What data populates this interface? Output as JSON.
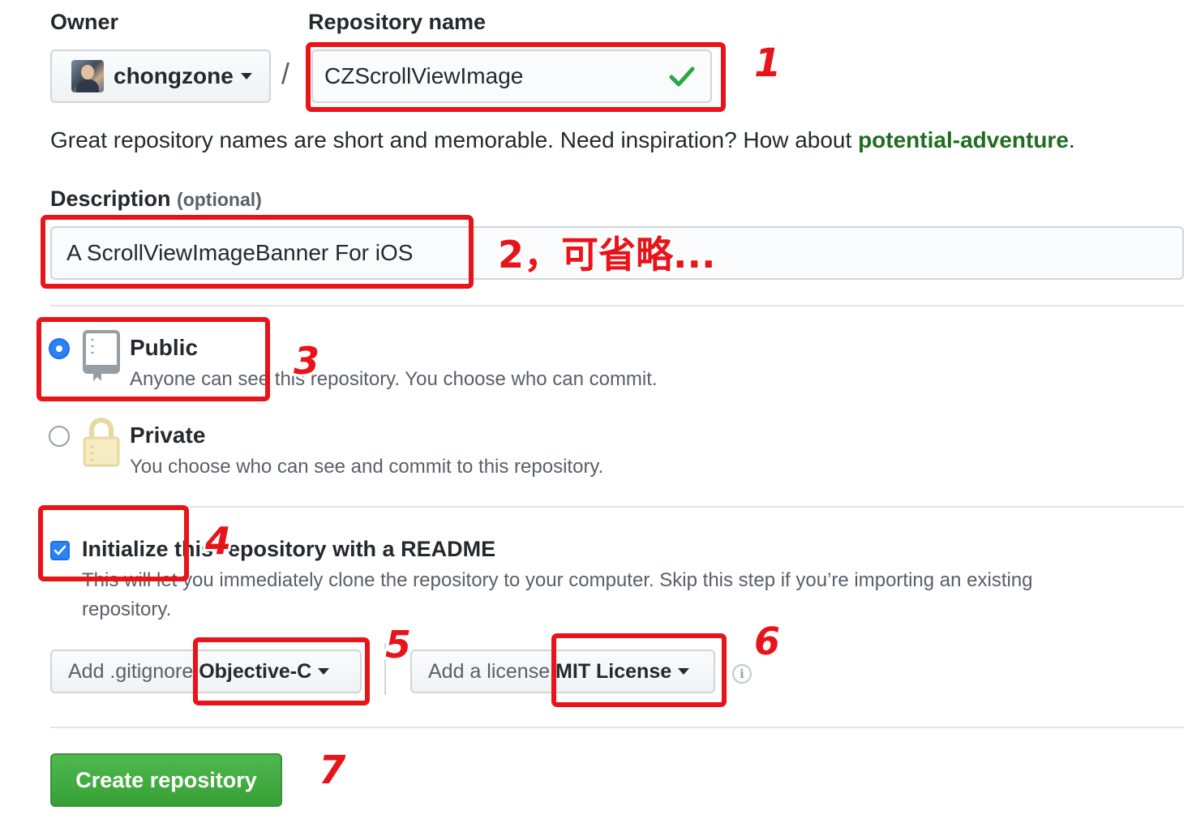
{
  "owner": {
    "label": "Owner",
    "name": "chongzone"
  },
  "repo": {
    "label": "Repository name",
    "value": "CZScrollViewImage",
    "slash": "/"
  },
  "hint": {
    "text": "Great repository names are short and memorable. Need inspiration? How about ",
    "suggestion": "potential-adventure",
    "end": "."
  },
  "description": {
    "label": "Description",
    "optional": "(optional)",
    "value": "A ScrollViewImageBanner For iOS"
  },
  "visibility": {
    "public": {
      "title": "Public",
      "desc": "Anyone can see this repository. You choose who can commit.",
      "selected": true
    },
    "private": {
      "title": "Private",
      "desc": "You choose who can see and commit to this repository.",
      "selected": false
    }
  },
  "readme": {
    "label": "Initialize this repository with a README",
    "desc1": "This will let you immediately clone the repository to your computer. Skip this step if you’re importing an existing",
    "desc2": "repository.",
    "checked": true
  },
  "gitignore": {
    "prefix": "Add .gitignore: ",
    "value": "Objective-C"
  },
  "license": {
    "prefix": "Add a license: ",
    "value": "MIT License"
  },
  "create_button": "Create repository",
  "annotations": {
    "a1": "1",
    "a2": "2，可省略...",
    "a3": "3",
    "a4": "4",
    "a5": "5",
    "a6": "6",
    "a7": "7"
  },
  "colors": {
    "accent": "#2b82f7",
    "create": "#37a035",
    "annotation": "#e8141a",
    "suggestion": "#1f6d1f"
  }
}
